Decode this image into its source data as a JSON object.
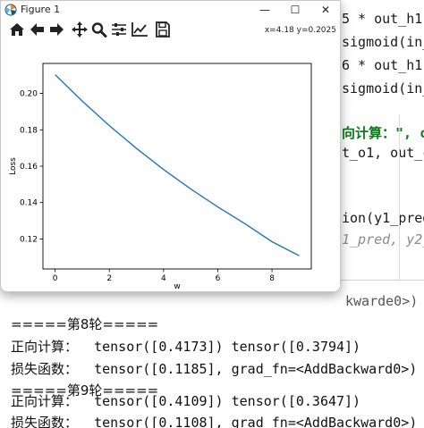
{
  "editor": {
    "lines": [
      {
        "text": "5 * out_h1",
        "style": "plain"
      },
      {
        "text": "sigmoid(in_",
        "style": "plain"
      },
      {
        "text": "6 * out_h1",
        "style": "plain"
      },
      {
        "text": "sigmoid(in_",
        "style": "plain"
      },
      {
        "text": "向计算：\", c",
        "style": "green"
      },
      {
        "text": "t_o1, out_c",
        "style": "plain"
      },
      {
        "text": "ion(y1_pred",
        "style": "plain"
      },
      {
        "text": "1_pred, y2_",
        "style": "hint"
      }
    ]
  },
  "console": {
    "partial_line": "kwarde0>)",
    "lines": [
      {
        "label": "=====第8轮=====",
        "value": ""
      },
      {
        "label": "正向计算：",
        "value": "  tensor([0.4173]) tensor([0.3794])"
      },
      {
        "label": "损失函数：",
        "value": "  tensor([0.1185], grad_fn=<AddBackward0>)"
      },
      {
        "label": "=====第9轮=====",
        "value": ""
      },
      {
        "label": "正向计算：",
        "value": "  tensor([0.4109]) tensor([0.3647])"
      },
      {
        "label": "损失函数：",
        "value": "  tensor([0.1108], grad_fn=<AddBackward0>)"
      }
    ]
  },
  "figure": {
    "title": "Figure 1",
    "window_controls": {
      "minimize": "—",
      "maximize": "☐",
      "close": "✕"
    },
    "toolbar": {
      "tools": [
        "home-icon",
        "back-arrow-icon",
        "forward-arrow-icon",
        "pan-icon",
        "zoom-icon",
        "subplots-config-icon",
        "edit-axis-icon",
        "save-icon"
      ],
      "coords": "x=4.18  y=0.2025"
    }
  },
  "chart_data": {
    "type": "line",
    "title": "",
    "xlabel": "w",
    "ylabel": "Loss",
    "xlim": [
      -0.45,
      9.45
    ],
    "ylim": [
      0.1035,
      0.2165
    ],
    "xticks": [
      0,
      2,
      4,
      6,
      8
    ],
    "yticks": [
      0.12,
      0.14,
      0.16,
      0.18,
      0.2
    ],
    "ytick_labels": [
      "0.12",
      "0.14",
      "0.16",
      "0.18",
      "0.20"
    ],
    "grid": false,
    "series": [
      {
        "color": "#1f77b4",
        "x": [
          0,
          1,
          2,
          3,
          4,
          5,
          6,
          7,
          8,
          9
        ],
        "y": [
          0.2103,
          0.1958,
          0.1823,
          0.1698,
          0.1582,
          0.1475,
          0.1376,
          0.1284,
          0.1185,
          0.1108
        ]
      }
    ]
  }
}
